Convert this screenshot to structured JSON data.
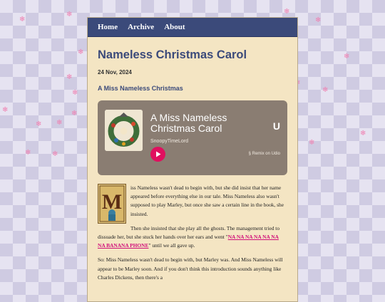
{
  "nav": {
    "home": "Home",
    "archive": "Archive",
    "about": "About"
  },
  "post": {
    "title": "Nameless Christmas Carol",
    "date": "24 Nov, 2024",
    "subtitle": "A Miss Nameless Christmas"
  },
  "player": {
    "song_title": "A Miss Nameless Christmas Carol",
    "artist": "SnoopyTimeLord",
    "logo": "U",
    "remix_label": "Remix on Udio",
    "play_icon": "play-icon",
    "accent": "#e0105f"
  },
  "body": {
    "dropcap_letter": "M",
    "p1": "iss Nameless wasn't dead to begin with, but she did insist that her name appeared before everything else in our tale. Miss Nameless also wasn't supposed to play Marley, but once she saw a certain line in the book, she insisted.",
    "p2_before": "Then she insisted that she play all the ghosts. The management tried to dissuade her, but she stuck her hands over her ears and went \"",
    "p2_link": "NA NA NA NA NA NA NA BANANA PHONE",
    "p2_after": "\" until we all gave up.",
    "p3": "So: Miss Nameless wasn't dead to begin with, but Marley was. And Miss Nameless will appear to be Marley soon. And if you don't think this introduction sounds anything like Charles Dickens, then there's a"
  },
  "colors": {
    "nav_bg": "#3b4a7a",
    "page_bg": "#f4e5c3",
    "link": "#d0107a",
    "snow": "#f07fb0"
  }
}
